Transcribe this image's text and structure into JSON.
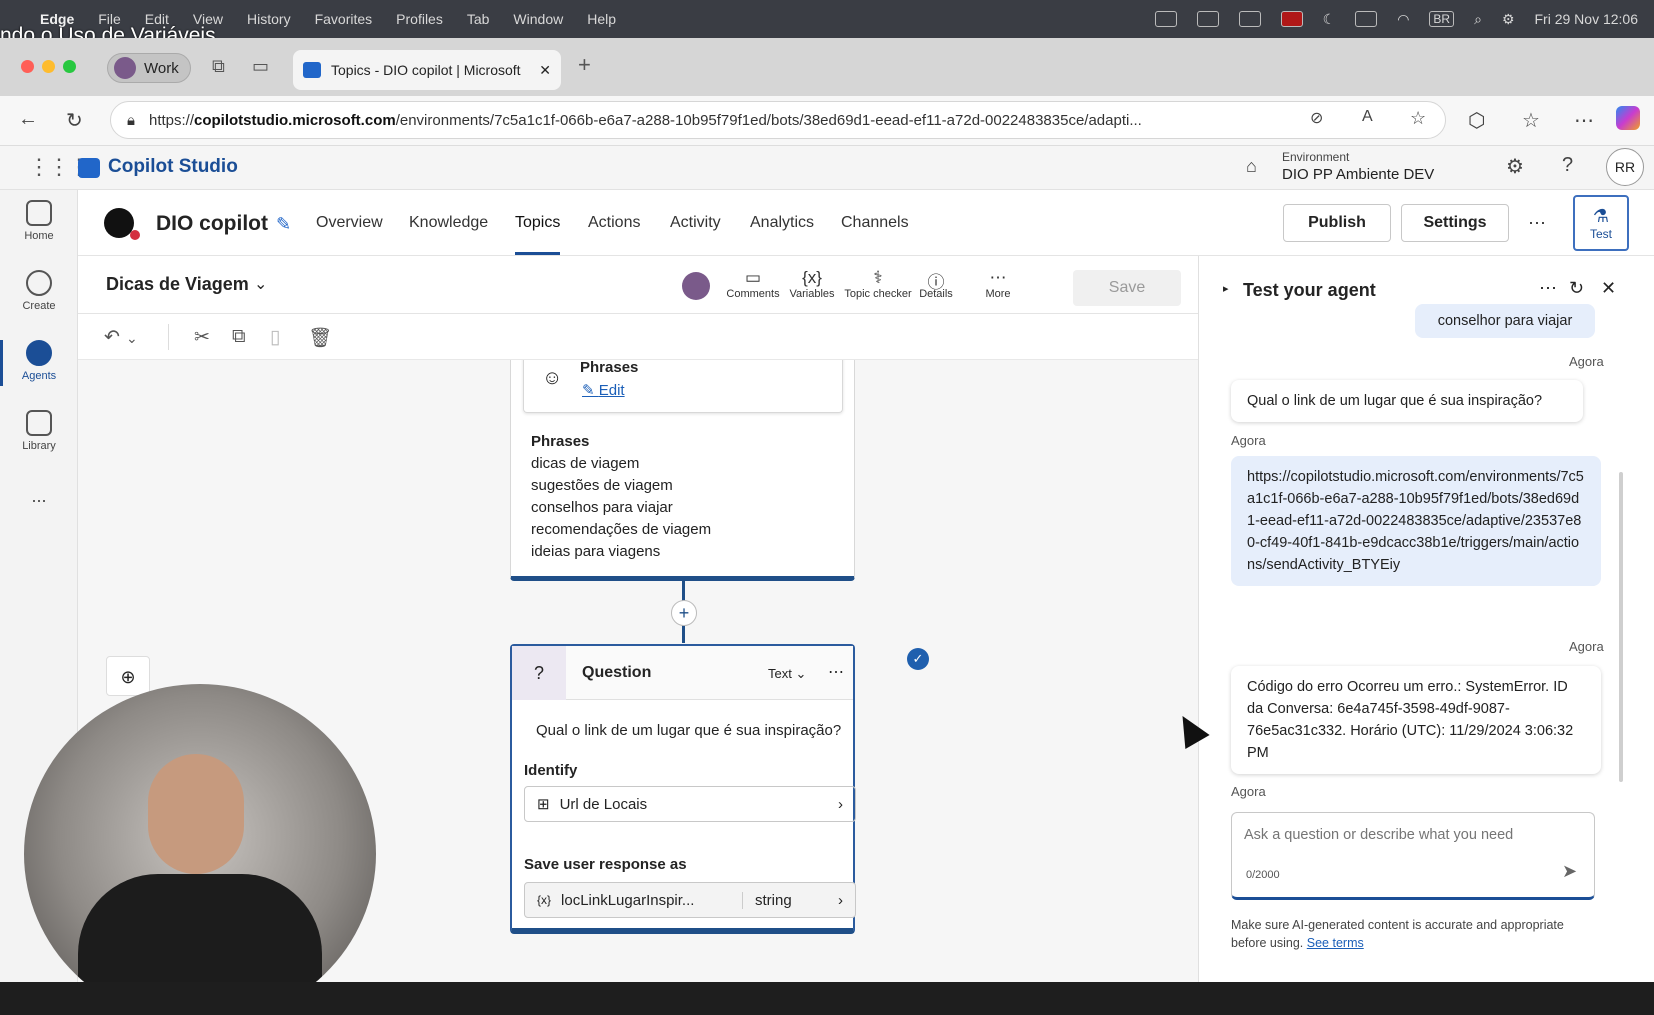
{
  "menubar": {
    "apple": "",
    "app": "Edge",
    "items": [
      "File",
      "Edit",
      "View",
      "History",
      "Favorites",
      "Profiles",
      "Tab",
      "Window",
      "Help"
    ],
    "lang": "BR",
    "datetime": "Fri 29 Nov  12:06"
  },
  "overlay_title": "ndo o Uso de Variáveis",
  "browser": {
    "profile": "Work",
    "tab_title": "Topics - DIO copilot | Microsoft",
    "url_prefix": "https://",
    "url_domain": "copilotstudio.microsoft.com",
    "url_rest": "/environments/7c5a1c1f-066b-e6a7-a288-10b95f79f1ed/bots/38ed69d1-eead-ef11-a72d-0022483835ce/adapti..."
  },
  "app": {
    "name": "Copilot Studio",
    "env_label": "Environment",
    "env_value": "DIO PP Ambiente DEV",
    "user_initials": "RR"
  },
  "rail": [
    {
      "label": "Home"
    },
    {
      "label": "Create"
    },
    {
      "label": "Agents"
    },
    {
      "label": "Library"
    }
  ],
  "rail_more": "...",
  "bot": {
    "name": "DIO copilot",
    "tabs": [
      "Overview",
      "Knowledge",
      "Topics",
      "Actions",
      "Activity",
      "Analytics",
      "Channels"
    ],
    "active_tab": "Topics",
    "publish": "Publish",
    "settings": "Settings",
    "more": "···",
    "test": "Test"
  },
  "topic": {
    "name": "Dicas de Viagem",
    "tools": [
      "Comments",
      "Variables",
      "Topic checker",
      "Details",
      "More"
    ],
    "save": "Save"
  },
  "trigger": {
    "header": "Phrases",
    "edit": "Edit",
    "phrases_title": "Phrases",
    "phrases": [
      "dicas de viagem",
      "sugestões de viagem",
      "conselhos para viajar",
      "recomendações de viagem",
      "ideias para viagens"
    ]
  },
  "question": {
    "title": "Question",
    "type": "Text",
    "prompt": "Qual o link de um lugar que é sua inspiração?",
    "identify_label": "Identify",
    "identify_value": "Url de Locais",
    "save_label": "Save user response as",
    "var_name": "locLinkLugarInspir...",
    "var_type": "string"
  },
  "test_pane": {
    "title": "Test your agent",
    "user_msg": "conselhor para viajar",
    "ts": "Agora",
    "bot_msg_1": "Qual o link de um lugar que é sua inspiração?",
    "user_link": "https://copilotstudio.microsoft.com/environments/7c5a1c1f-066b-e6a7-a288-10b95f79f1ed/bots/38ed69d1-eead-ef11-a72d-0022483835ce/adaptive/23537e80-cf49-40f1-841b-e9dcacc38b1e/triggers/main/actions/sendActivity_BTYEiy",
    "error_msg": "Código do erro Ocorreu um erro.: SystemError. ID da Conversa: 6e4a745f-3598-49df-9087-76e5ac31c332. Horário (UTC): 11/29/2024 3:06:32 PM",
    "input_placeholder": "Ask a question or describe what you need",
    "counter": "0/2000",
    "disclaimer": "Make sure AI-generated content is accurate and appropriate before using.",
    "see_terms": "See terms"
  },
  "colors": {
    "accent": "#1b4e96",
    "user_bubble": "#e6eefb",
    "close_red": "#ff5f57",
    "min_yellow": "#febc2e",
    "max_green": "#28c840"
  }
}
